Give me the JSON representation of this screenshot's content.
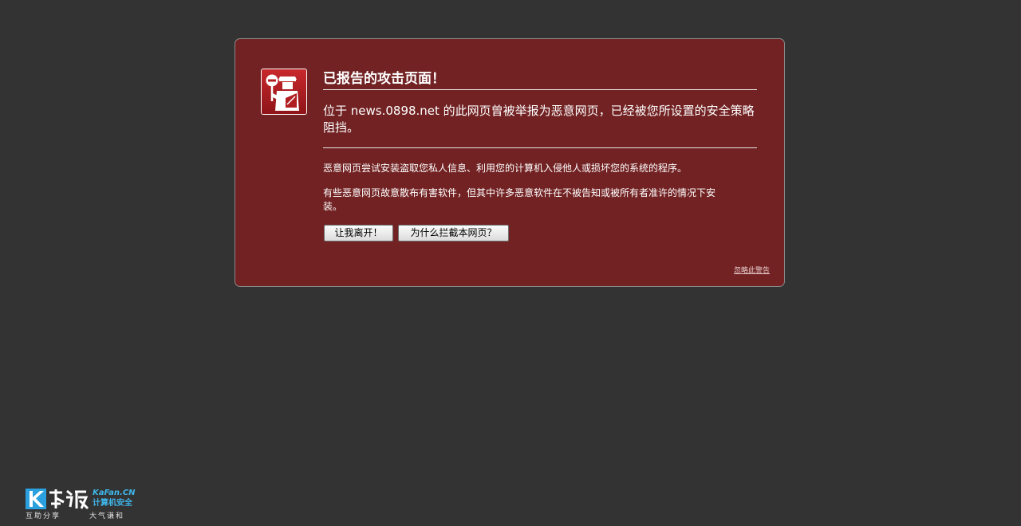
{
  "warning": {
    "title": "已报告的攻击页面！",
    "intro": "位于 news.0898.net 的此网页曾被举报为恶意网页，已经被您所设置的安全策略阻挡。",
    "paragraph1": "恶意网页尝试安装盗取您私人信息、利用您的计算机入侵他人或损坏您的系统的程序。",
    "paragraph2": "有些恶意网页故意散布有害软件，但其中许多恶意软件在不被告知或被所有者准许的情况下安装。",
    "get_me_out_label": "让我离开！",
    "why_blocked_label": "为什么拦截本网页？",
    "ignore_label": "忽略此警告",
    "icon": "police-officer-stop-icon",
    "background_color": "#722223",
    "icon_color": "#ad1f23"
  },
  "watermark": {
    "cn_text": "KaFan.CN",
    "security_text": "计算机安全",
    "slogan_left": "互助分享",
    "slogan_right": "大气谦和"
  }
}
